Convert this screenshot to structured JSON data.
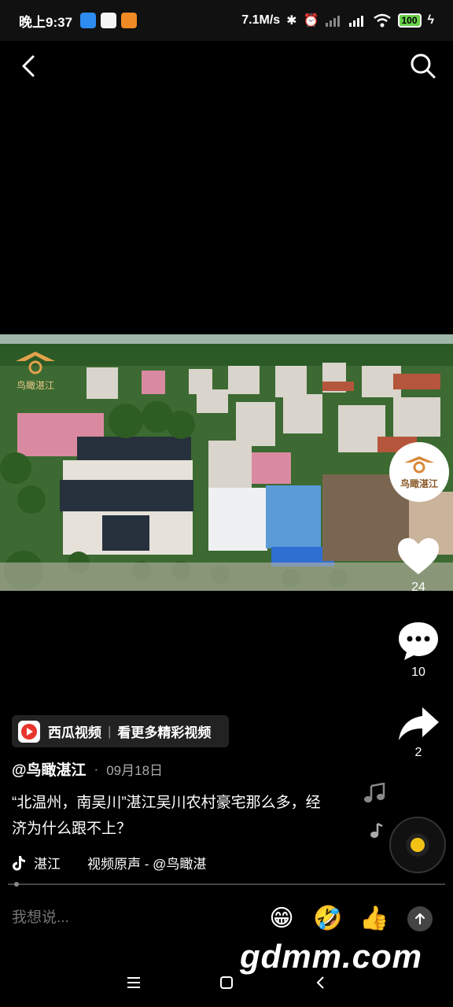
{
  "status": {
    "time": "晚上9:37",
    "speed": "7.1M/s",
    "battery": "100",
    "app_icons": [
      "blue-app-icon",
      "browser-app-icon",
      "orange-app-icon"
    ]
  },
  "video": {
    "watermark_name": "鸟瞰湛江"
  },
  "actions": {
    "avatar_name": "鸟瞰湛江",
    "likes": "24",
    "comments": "10",
    "shares": "2"
  },
  "promo": {
    "app_name": "西瓜视频",
    "text": "看更多精彩视频"
  },
  "post": {
    "author": "@鸟瞰湛江",
    "date": "09月18日",
    "separator": "·",
    "caption": "“北温州，南吴川”湛江吴川农村豪宅那么多，经济为什么跟不上？",
    "location": "湛江",
    "music": "视频原声 - @鸟瞰湛"
  },
  "comment": {
    "placeholder": "我想说..."
  },
  "watermark": "gdmm.com",
  "colors": {
    "background": "#000000",
    "accent_yellow": "#f2c315",
    "promo_bg": "#222222"
  }
}
